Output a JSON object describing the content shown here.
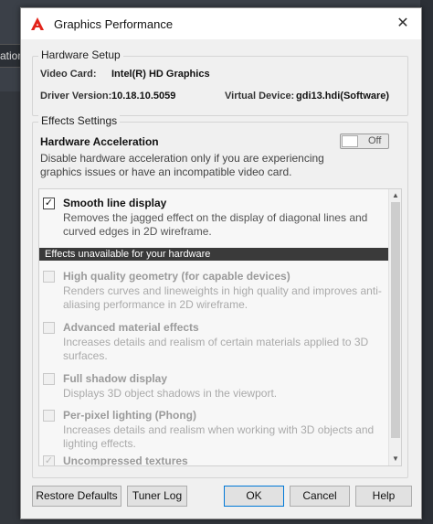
{
  "background": {
    "left_label": "ation"
  },
  "window": {
    "title": "Graphics Performance",
    "close_glyph": "✕"
  },
  "hardware_setup": {
    "legend": "Hardware Setup",
    "video_card_label": "Video Card:",
    "video_card_value": "Intel(R) HD Graphics",
    "driver_version_label": "Driver Version:",
    "driver_version_value": "10.18.10.5059",
    "virtual_device_label": "Virtual Device:",
    "virtual_device_value": "gdi13.hdi(Software)"
  },
  "effects_settings": {
    "legend": "Effects Settings",
    "hardware_acceleration": {
      "title": "Hardware Acceleration",
      "description": "Disable hardware acceleration only if you are experiencing graphics issues or have an incompatible video card.",
      "toggle_label": "Off"
    },
    "items": [
      {
        "title": "Smooth line display",
        "description": "Removes the jagged effect on the display of diagonal lines and curved edges in 2D wireframe.",
        "checked": true,
        "enabled": true
      },
      {
        "title": "High quality geometry (for capable devices)",
        "description": "Renders curves and lineweights in high quality and improves anti-aliasing performance in 2D wireframe.",
        "checked": false,
        "enabled": false
      },
      {
        "title": "Advanced material effects",
        "description": "Increases details and realism of certain materials applied to 3D surfaces.",
        "checked": false,
        "enabled": false
      },
      {
        "title": "Full shadow display",
        "description": "Displays 3D object shadows in the viewport.",
        "checked": false,
        "enabled": false
      },
      {
        "title": "Per-pixel lighting (Phong)",
        "description": "Increases details and realism when working with 3D objects and lighting effects.",
        "checked": false,
        "enabled": false
      },
      {
        "title": "Uncompressed textures",
        "description": "",
        "checked": true,
        "enabled": false
      }
    ],
    "unavailable_header": "Effects unavailable for your hardware",
    "check_glyph": "✓"
  },
  "buttons": {
    "restore_defaults": "Restore Defaults",
    "tuner_log": "Tuner Log",
    "ok": "OK",
    "cancel": "Cancel",
    "help": "Help"
  },
  "colors": {
    "accent": "#0078d7",
    "logo": "#e2231a",
    "section_bar": "#3a3a3a"
  }
}
